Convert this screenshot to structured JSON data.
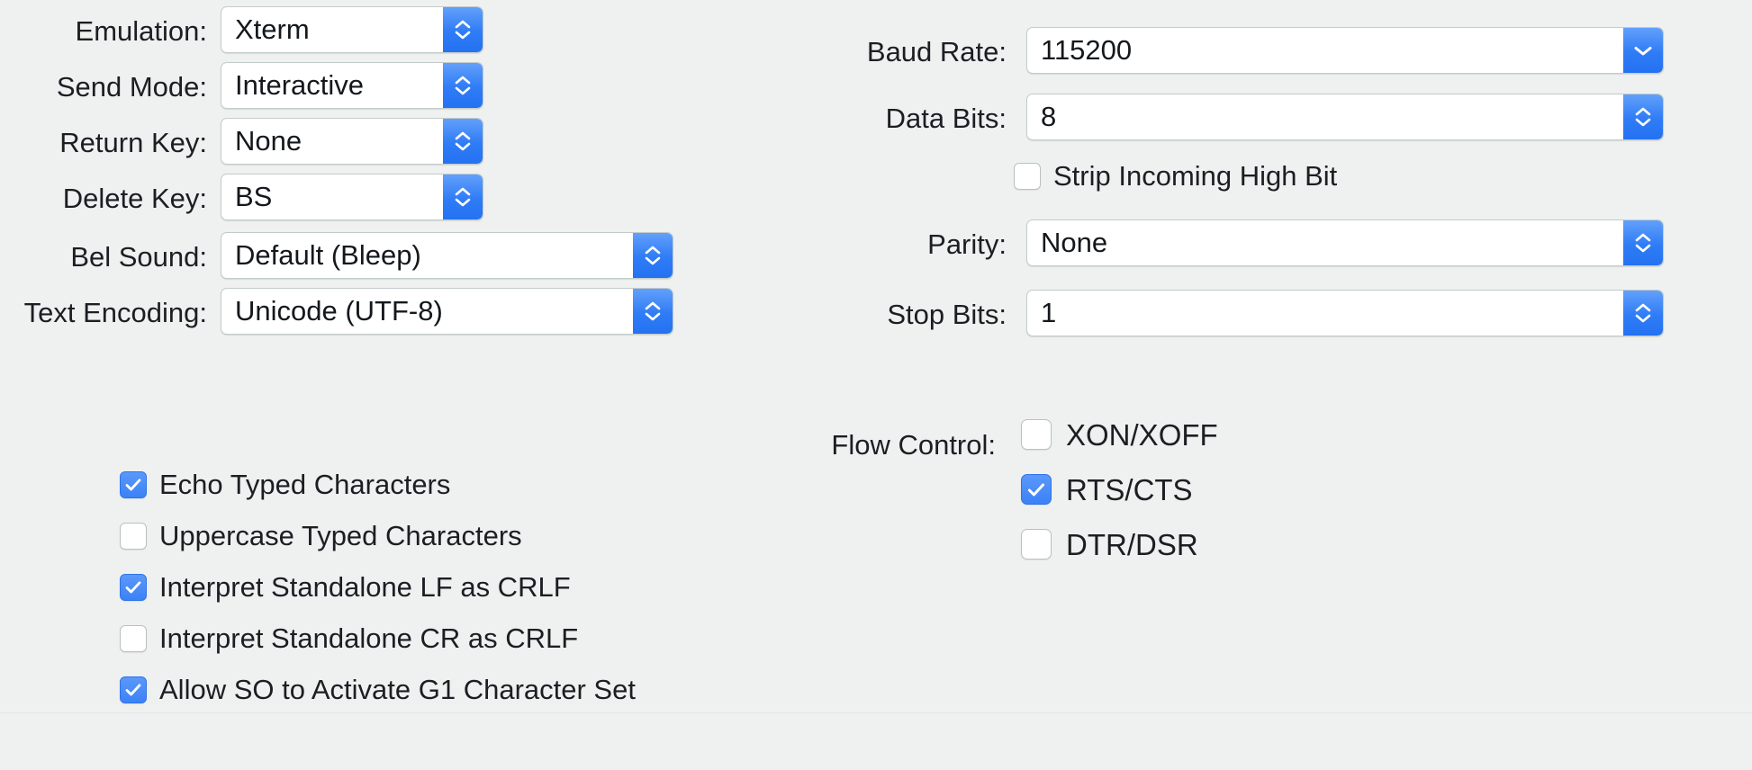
{
  "panel": {
    "background_color": "#eef1f0",
    "accent_color": "#2f7cf6"
  },
  "terminal_section": {
    "fields": [
      {
        "label": "Emulation:",
        "value": "Xterm",
        "control": "popup-button"
      },
      {
        "label": "Send Mode:",
        "value": "Interactive",
        "control": "popup-button"
      },
      {
        "label": "Return Key:",
        "value": "None",
        "control": "popup-button"
      },
      {
        "label": "Delete Key:",
        "value": "BS",
        "control": "popup-button"
      },
      {
        "label": "Bel Sound:",
        "value": "Default (Bleep)",
        "control": "popup-button"
      },
      {
        "label": "Text Encoding:",
        "value": "Unicode (UTF-8)",
        "control": "popup-button"
      }
    ],
    "checkboxes": [
      {
        "label": "Echo Typed Characters",
        "checked": true
      },
      {
        "label": "Uppercase Typed Characters",
        "checked": false
      },
      {
        "label": "Interpret Standalone LF as CRLF",
        "checked": true
      },
      {
        "label": "Interpret Standalone CR as CRLF",
        "checked": false
      },
      {
        "label": "Allow SO to Activate G1 Character Set",
        "checked": true
      }
    ]
  },
  "serial_section": {
    "fields": [
      {
        "label": "Baud Rate:",
        "value": "115200",
        "control": "combo-box"
      },
      {
        "label": "Data Bits:",
        "value": "8",
        "control": "popup-button"
      },
      {
        "label": "Parity:",
        "value": "None",
        "control": "popup-button"
      },
      {
        "label": "Stop Bits:",
        "value": "1",
        "control": "popup-button"
      }
    ],
    "strip_high_bit": {
      "label": "Strip Incoming High Bit",
      "checked": false
    },
    "flow_control": {
      "label": "Flow Control:",
      "options": [
        {
          "label": "XON/XOFF",
          "checked": false
        },
        {
          "label": "RTS/CTS",
          "checked": true
        },
        {
          "label": "DTR/DSR",
          "checked": false
        }
      ]
    }
  },
  "icons": {
    "stepper": "chevron-up-down-icon",
    "combo": "chevron-down-icon",
    "check": "checkmark-icon"
  }
}
